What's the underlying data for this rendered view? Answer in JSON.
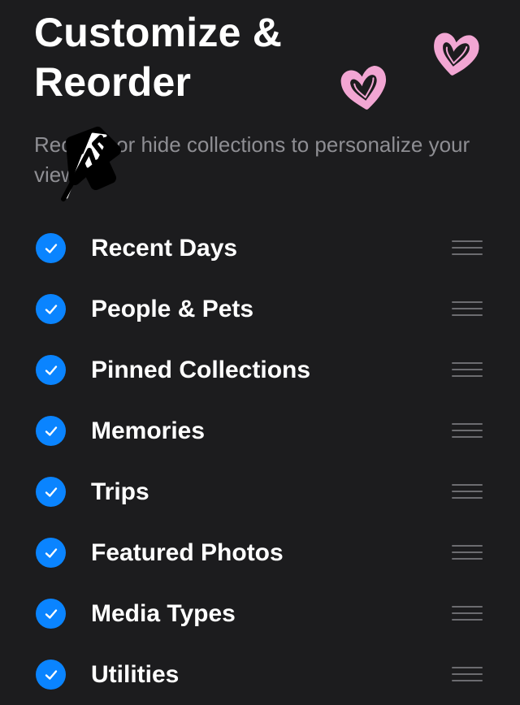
{
  "header": {
    "title_line1": "Customize &",
    "title_line2": "Reorder",
    "subtitle": "Reorder or hide collections to personalize your view."
  },
  "collections": [
    {
      "label": "Recent Days",
      "checked": true
    },
    {
      "label": "People & Pets",
      "checked": true
    },
    {
      "label": "Pinned Collections",
      "checked": true
    },
    {
      "label": "Memories",
      "checked": true
    },
    {
      "label": "Trips",
      "checked": true
    },
    {
      "label": "Featured Photos",
      "checked": true
    },
    {
      "label": "Media Types",
      "checked": true
    },
    {
      "label": "Utilities",
      "checked": true
    }
  ],
  "icons": {
    "check": "checkmark-icon",
    "reorder": "reorder-handle-icon",
    "stickers": [
      "arrow-sticker-icon",
      "heart-sticker-icon",
      "heart-sticker-icon"
    ]
  },
  "colors": {
    "background": "#1c1c1e",
    "accent": "#0a84ff",
    "subtitle": "#8e8e93",
    "handle": "#6c6c70",
    "heart": "#f2a6d3"
  }
}
